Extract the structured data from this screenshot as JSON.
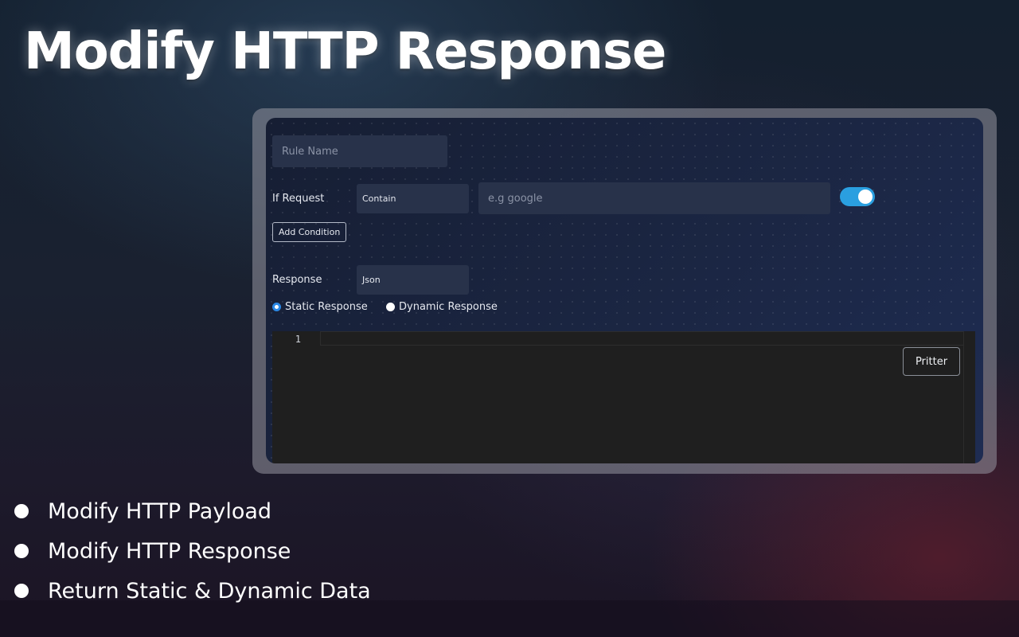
{
  "hero": {
    "title": "Modify HTTP Response"
  },
  "form": {
    "rule_name_placeholder": "Rule Name",
    "if_request_label": "If Request",
    "condition_value": "Contain",
    "url_placeholder": "e.g google",
    "toggle_on": true,
    "add_condition_label": "Add Condition",
    "response_label": "Response",
    "response_type_value": "Json",
    "radio_options": [
      {
        "label": "Static Response",
        "checked": true
      },
      {
        "label": "Dynamic Response",
        "checked": false
      }
    ]
  },
  "editor": {
    "line_numbers": [
      "1"
    ],
    "pritter_label": "Pritter"
  },
  "features": [
    "Modify HTTP Payload",
    "Modify HTTP Response",
    "Return Static & Dynamic Data"
  ],
  "colors": {
    "toggle_accent": "#2a9fe0",
    "radio_accent": "#2b88e6",
    "panel_bg": "#18213a",
    "field_bg": "#28324a",
    "editor_bg": "#1f1f1f"
  }
}
